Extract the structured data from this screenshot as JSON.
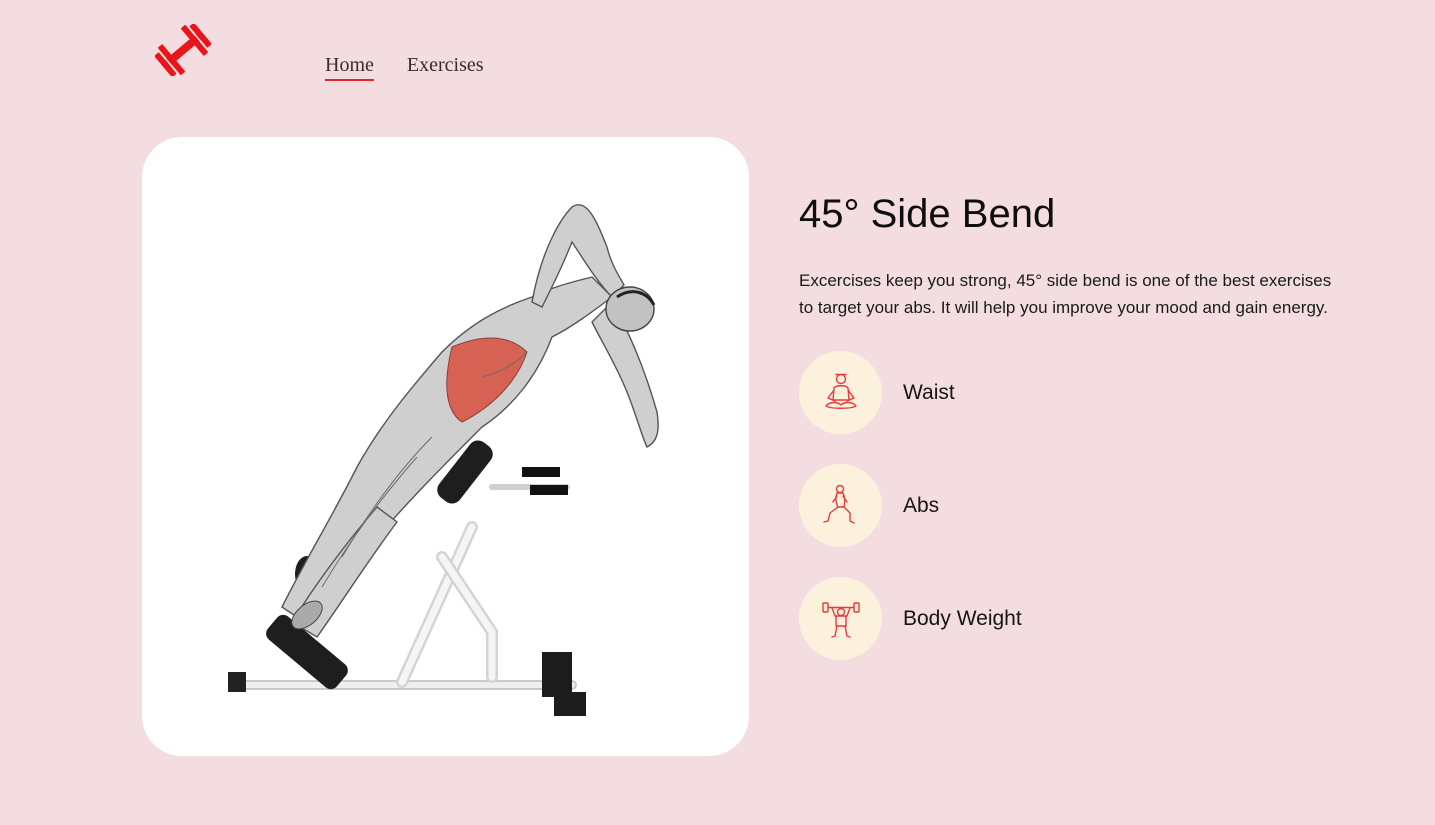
{
  "header": {
    "logo_icon": "dumbbell-icon",
    "nav": [
      {
        "label": "Home",
        "active": true
      },
      {
        "label": "Exercises",
        "active": false
      }
    ]
  },
  "exercise": {
    "image_icon": "side-bend-illustration",
    "title": "45° Side Bend",
    "description": "Excercises keep you strong, 45° side bend is one of the best exercises to target your abs. It will help you improve your mood and gain energy.",
    "tags": [
      {
        "label": "Waist",
        "icon": "meditation-icon"
      },
      {
        "label": "Abs",
        "icon": "lunge-icon"
      },
      {
        "label": "Body Weight",
        "icon": "weightlifter-icon"
      }
    ]
  },
  "colors": {
    "background": "#f4dde1",
    "accent": "#e0262a",
    "card": "#ffffff",
    "tag_circle": "#fcf1dd"
  }
}
